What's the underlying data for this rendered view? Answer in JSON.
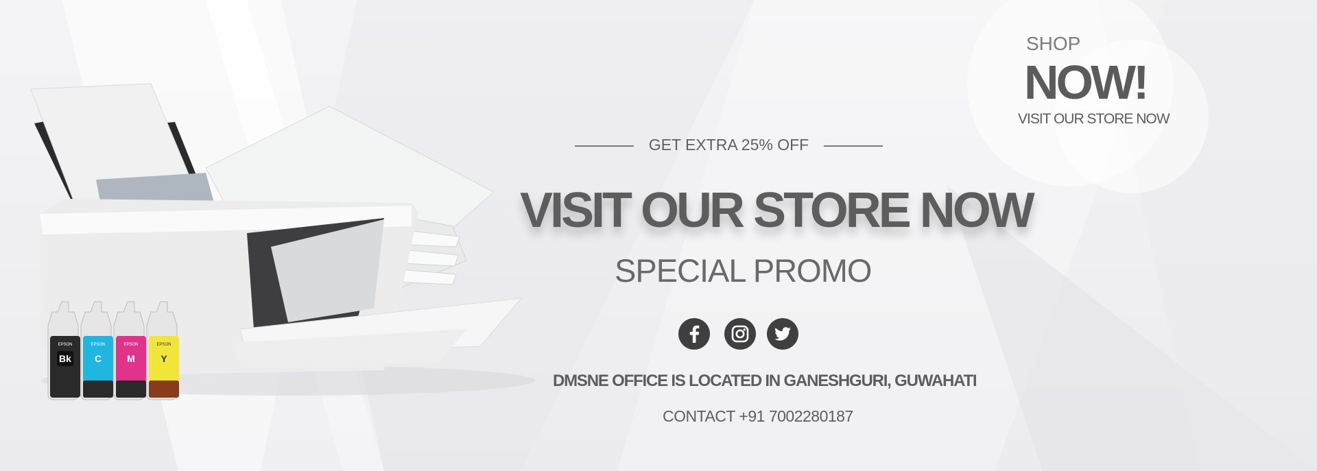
{
  "promo": {
    "shop_small": "SHOP",
    "shop_big": "NOW!",
    "shop_sub": "VISIT  OUR STORE NOW",
    "offer": "GET EXTRA 25% OFF",
    "headline": "VISIT OUR STORE NOW",
    "subheadline": "SPECIAL PROMO",
    "location": "DMSNE OFFICE IS LOCATED IN GANESHGURI, GUWAHATI",
    "contact": "CONTACT +91 7002280187"
  },
  "social": [
    {
      "name": "facebook",
      "icon": "facebook-icon"
    },
    {
      "name": "instagram",
      "icon": "instagram-icon"
    },
    {
      "name": "twitter",
      "icon": "twitter-icon"
    }
  ],
  "ink_bottles": {
    "brand": "EPSON",
    "items": [
      {
        "code": "Bk",
        "label": "Black",
        "color": "#2a2a2a"
      },
      {
        "code": "C",
        "label": "Cyan",
        "color": "#1fb6e0"
      },
      {
        "code": "M",
        "label": "Magenta",
        "color": "#e0348c"
      },
      {
        "code": "Y",
        "label": "Yellow",
        "color": "#f2e53a"
      }
    ]
  },
  "colors": {
    "background": "#f0f0f2",
    "text": "#5e5d5d",
    "icon_circle": "#403f3f"
  }
}
